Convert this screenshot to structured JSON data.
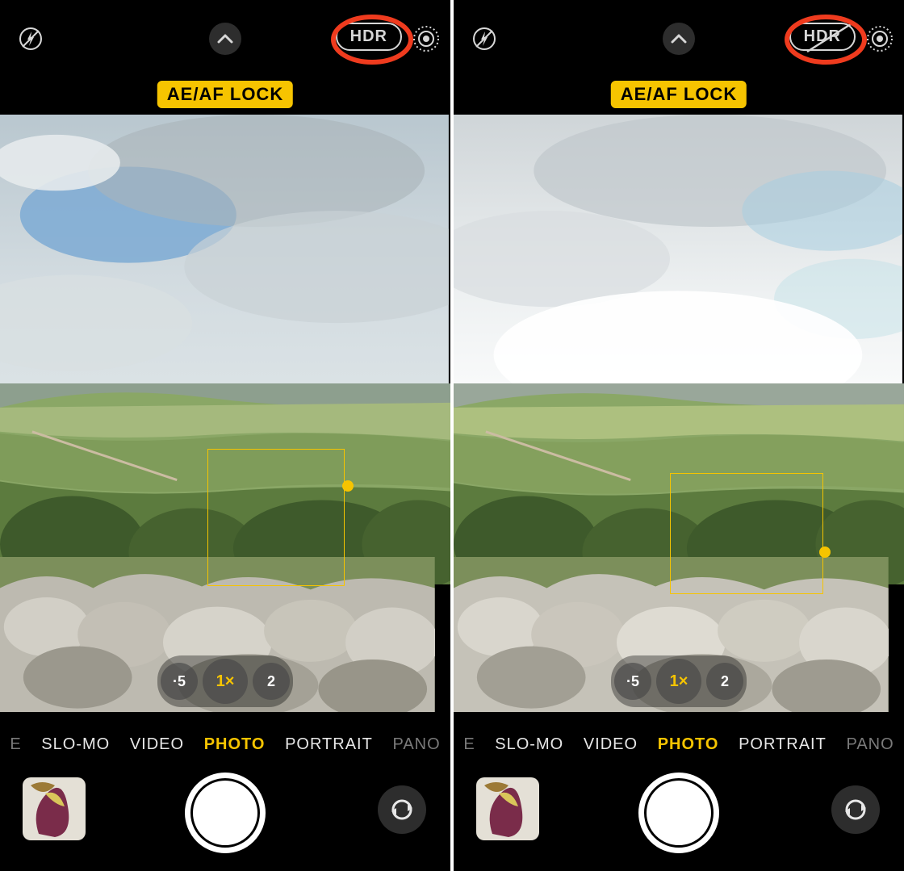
{
  "colors": {
    "accent": "#f6c400",
    "annotation": "#ef3b1e"
  },
  "left": {
    "hdr_label": "HDR",
    "hdr_state": "on",
    "flash_state": "off",
    "live_state": "on",
    "lock_label": "AE/AF LOCK",
    "zoom": [
      "·5",
      "1×",
      "2"
    ],
    "zoom_selected": 1,
    "modes": [
      "E",
      "SLO-MO",
      "VIDEO",
      "PHOTO",
      "PORTRAIT",
      "PANO"
    ],
    "mode_selected": 3,
    "icons": {
      "flash": "flash-off-icon",
      "chevron": "chevron-up-icon",
      "live": "live-photo-icon",
      "flip": "camera-flip-icon"
    },
    "thumbnail": "last-photo-thumbnail"
  },
  "right": {
    "hdr_label": "HDR",
    "hdr_state": "off",
    "flash_state": "off",
    "live_state": "on",
    "lock_label": "AE/AF LOCK",
    "zoom": [
      "·5",
      "1×",
      "2"
    ],
    "zoom_selected": 1,
    "modes": [
      "E",
      "SLO-MO",
      "VIDEO",
      "PHOTO",
      "PORTRAIT",
      "PANO"
    ],
    "mode_selected": 3,
    "icons": {
      "flash": "flash-off-icon",
      "chevron": "chevron-up-icon",
      "live": "live-photo-icon",
      "flip": "camera-flip-icon"
    },
    "thumbnail": "last-photo-thumbnail"
  }
}
